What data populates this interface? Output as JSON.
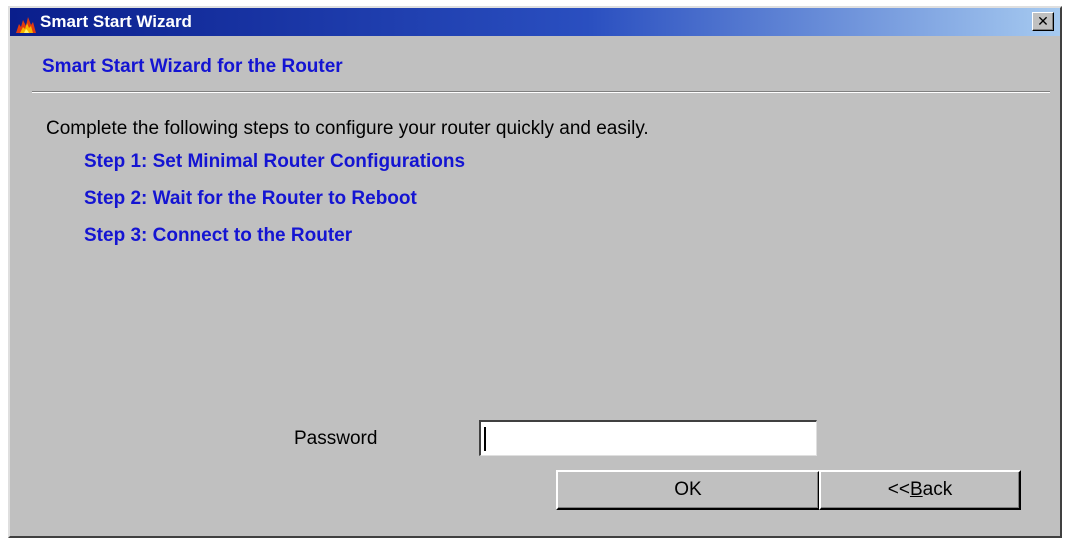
{
  "window": {
    "title": "Smart Start Wizard",
    "close_glyph": "✕",
    "icon": "flame-icon"
  },
  "wizard": {
    "header": "Smart Start Wizard for the Router",
    "intro": "Complete the following steps to configure your router quickly and easily.",
    "steps": [
      {
        "label": "Step 1: Set Minimal Router Configurations"
      },
      {
        "label": "Step 2: Wait for the Router to Reboot"
      },
      {
        "label": "Step 3: Connect to the Router"
      }
    ]
  },
  "form": {
    "password_label": "Password",
    "password_value": ""
  },
  "buttons": {
    "ok_label": "OK",
    "back_prefix": "<<",
    "back_mnemonic": "B",
    "back_rest": "ack"
  },
  "colors": {
    "link_blue": "#1414d2",
    "face": "#c0c0c0",
    "title_start": "#0a1e8c",
    "title_end": "#a6caf0"
  }
}
